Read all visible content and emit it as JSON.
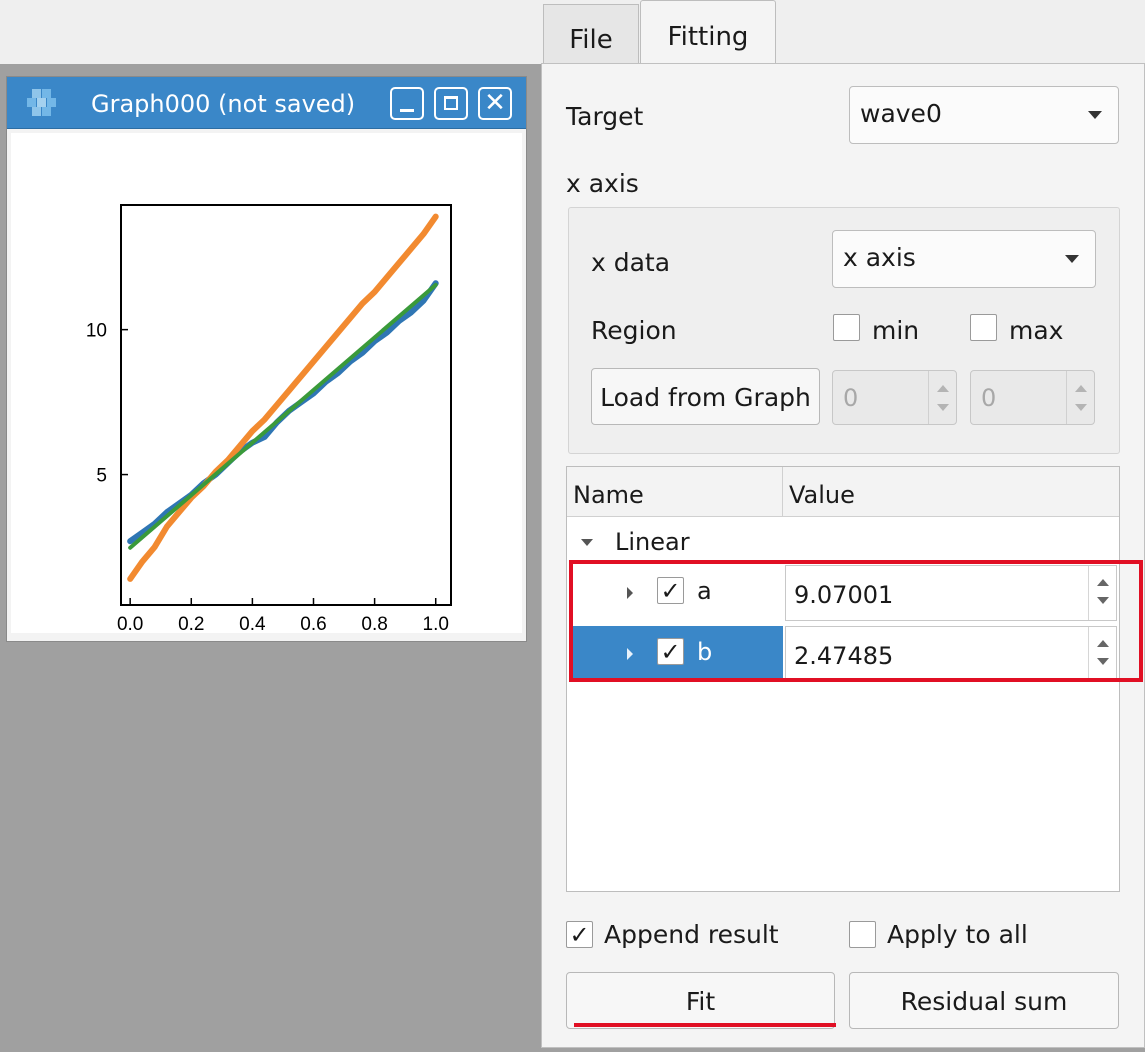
{
  "graph_window": {
    "title": "Graph000 (not saved)",
    "controls": [
      "minimize",
      "maximize",
      "close"
    ],
    "close_glyph": "✕"
  },
  "tabs": [
    {
      "label": "File",
      "active": false
    },
    {
      "label": "Fitting",
      "active": true
    }
  ],
  "fitting": {
    "target_label": "Target",
    "target_value": "wave0",
    "x_axis_section": "x axis",
    "x_data_label": "x data",
    "x_data_value": "x axis",
    "region_label": "Region",
    "min_label": "min",
    "max_label": "max",
    "load_button": "Load from Graph",
    "min_value": "0",
    "max_value": "0",
    "table": {
      "headers": [
        "Name",
        "Value"
      ],
      "group": "Linear",
      "params": [
        {
          "name": "a",
          "value": "9.07001",
          "checked": true,
          "selected": false
        },
        {
          "name": "b",
          "value": "2.47485",
          "checked": true,
          "selected": true
        }
      ]
    },
    "append_result_label": "Append result",
    "append_result_checked": true,
    "apply_to_all_label": "Apply to all",
    "apply_to_all_checked": false,
    "fit_button": "Fit",
    "residual_button": "Residual sum",
    "check_glyph": "✓"
  },
  "colors": {
    "titlebar": "#3a87c8",
    "selection": "#3a87c8",
    "highlight": "#e10f24",
    "series_blue": "#2f76b4",
    "series_orange": "#f28a30",
    "fit_green": "#3a9a3a"
  },
  "chart_data": {
    "type": "line",
    "title": "",
    "xlabel": "",
    "ylabel": "",
    "xlim": [
      -0.03,
      1.05
    ],
    "ylim": [
      0.5,
      14.3
    ],
    "xticks": [
      "0.0",
      "0.2",
      "0.4",
      "0.6",
      "0.8",
      "1.0"
    ],
    "xtick_values": [
      0.0,
      0.2,
      0.4,
      0.6,
      0.8,
      1.0
    ],
    "yticks": [
      "5",
      "10"
    ],
    "ytick_values": [
      5,
      10
    ],
    "series": [
      {
        "color": "#2f76b4",
        "x": [
          0.0,
          0.04,
          0.08,
          0.12,
          0.16,
          0.2,
          0.24,
          0.28,
          0.32,
          0.36,
          0.4,
          0.44,
          0.48,
          0.52,
          0.56,
          0.6,
          0.64,
          0.68,
          0.72,
          0.76,
          0.8,
          0.84,
          0.88,
          0.92,
          0.96,
          1.0
        ],
        "y": [
          2.7,
          3.0,
          3.3,
          3.7,
          4.0,
          4.3,
          4.7,
          5.0,
          5.4,
          5.8,
          6.1,
          6.3,
          6.8,
          7.2,
          7.5,
          7.8,
          8.2,
          8.5,
          8.9,
          9.2,
          9.6,
          9.9,
          10.3,
          10.6,
          11.0,
          11.6
        ]
      },
      {
        "color": "#f28a30",
        "x": [
          0.0,
          0.04,
          0.08,
          0.12,
          0.16,
          0.2,
          0.24,
          0.28,
          0.32,
          0.36,
          0.4,
          0.44,
          0.48,
          0.52,
          0.56,
          0.6,
          0.64,
          0.68,
          0.72,
          0.76,
          0.8,
          0.84,
          0.88,
          0.92,
          0.96,
          1.0
        ],
        "y": [
          1.4,
          2.0,
          2.5,
          3.2,
          3.7,
          4.2,
          4.6,
          5.1,
          5.5,
          6.0,
          6.5,
          6.9,
          7.4,
          7.9,
          8.4,
          8.9,
          9.4,
          9.9,
          10.4,
          10.9,
          11.3,
          11.8,
          12.3,
          12.8,
          13.3,
          13.9
        ]
      },
      {
        "color": "#3a9a3a",
        "x": [
          0.0,
          1.0
        ],
        "y": [
          2.47485,
          11.54486
        ]
      }
    ]
  }
}
